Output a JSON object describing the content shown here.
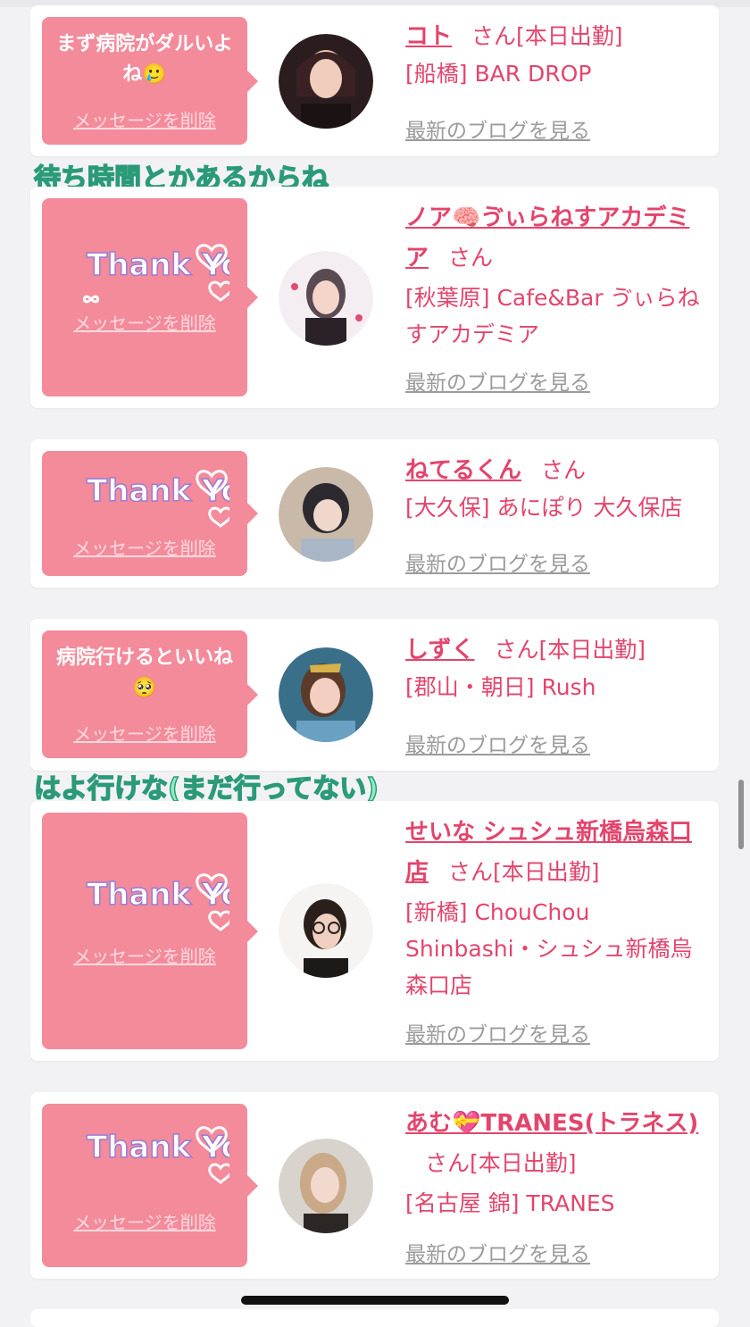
{
  "cards": [
    {
      "message": "まず病院がダルいよね🥲",
      "delete_label": "メッセージを削除",
      "name": "コト",
      "san": "さん",
      "status": "[本日出勤]",
      "shop": "[船橋] BAR DROP",
      "blog_link": "最新のブログを見る"
    },
    {
      "thank_you": "Thank You",
      "delete_label": "メッセージを削除",
      "name": "ノア🧠ゔぃらねすアカデミア",
      "san": "さん",
      "status": "",
      "shop": "[秋葉原] Cafe&Bar ゔぃらねすアカデミア",
      "blog_link": "最新のブログを見る"
    },
    {
      "thank_you": "Thank You",
      "delete_label": "メッセージを削除",
      "name": "ねてるくん",
      "san": "さん",
      "status": "",
      "shop": "[大久保] あにぽり 大久保店",
      "blog_link": "最新のブログを見る"
    },
    {
      "message": "病院行けるといいね🥺",
      "delete_label": "メッセージを削除",
      "name": "しずく",
      "san": "さん",
      "status": "[本日出勤]",
      "shop": "[郡山・朝日] Rush",
      "blog_link": "最新のブログを見る"
    },
    {
      "thank_you": "Thank You",
      "delete_label": "メッセージを削除",
      "name": "せいな シュシュ新橋烏森口店",
      "san": "さん",
      "status": "[本日出勤]",
      "shop": "[新橋] ChouChou Shinbashi・シュシュ新橋烏森口店",
      "blog_link": "最新のブログを見る"
    },
    {
      "thank_you": "Thank You",
      "delete_label": "メッセージを削除",
      "name": "あむ💝TRANES(トラネス)",
      "san": "さん",
      "status": "[本日出勤]",
      "shop": "[名古屋 錦] TRANES",
      "blog_link": "最新のブログを見る"
    }
  ],
  "overlays": {
    "first": "待ち時間とかあるからね",
    "second": "はよ行けな(まだ行ってない)"
  },
  "colors": {
    "accent": "#e3456c",
    "bubble": "#f38b9b",
    "overlay_text": "#8ef0c0"
  }
}
